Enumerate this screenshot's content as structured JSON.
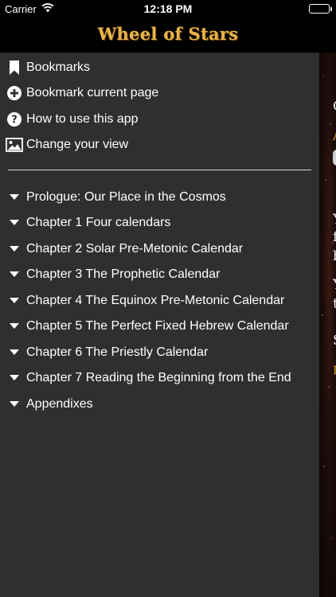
{
  "status_bar": {
    "carrier": "Carrier",
    "time": "12:18 PM"
  },
  "app": {
    "title": "Wheel of Stars",
    "title_color": "#e6b44a"
  },
  "menu": {
    "actions": [
      {
        "label": "Bookmarks",
        "icon": "bookmark-icon"
      },
      {
        "label": "Bookmark current page",
        "icon": "add-circle-icon"
      },
      {
        "label": "How to use this app",
        "icon": "help-circle-icon"
      },
      {
        "label": "Change your view",
        "icon": "image-icon"
      }
    ],
    "chapters": [
      {
        "label": "Prologue: Our Place in the Cosmos"
      },
      {
        "label": "Chapter 1 Four calendars"
      },
      {
        "label": "Chapter 2 Solar Pre-Metonic Calendar"
      },
      {
        "label": "Chapter 3 The Prophetic Calendar"
      },
      {
        "label": "Chapter 4 The Equinox Pre-Metonic Calendar"
      },
      {
        "label": "Chapter 5 The Perfect Fixed Hebrew Calendar"
      },
      {
        "label": "Chapter 6 The Priestly Calendar"
      },
      {
        "label": "Chapter 7 Reading the Beginning from the End"
      },
      {
        "label": "Appendixes"
      }
    ]
  },
  "content_peek": {
    "letters": [
      "C",
      "A",
      "Y",
      "f",
      "b",
      "Y",
      "t",
      "S",
      "I"
    ]
  }
}
